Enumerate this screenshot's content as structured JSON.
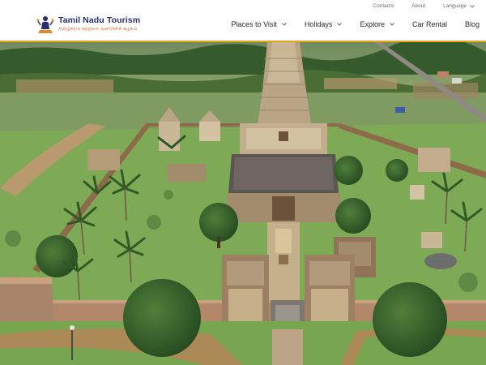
{
  "site": {
    "name": "Tamil Nadu Tourism",
    "tagline": "தமிழ்நாடு சுற்றுலா வளர்ச்சிக் கழகம்"
  },
  "utility_nav": {
    "contacts": "Contacts",
    "about": "About",
    "language": "Language"
  },
  "main_nav": [
    {
      "label": "Places to Visit",
      "has_dropdown": true
    },
    {
      "label": "Holidays",
      "has_dropdown": true
    },
    {
      "label": "Explore",
      "has_dropdown": true
    },
    {
      "label": "Car Rental",
      "has_dropdown": false
    },
    {
      "label": "Blog",
      "has_dropdown": false
    }
  ],
  "colors": {
    "accent": "#e6a623",
    "brand_navy": "#2c2c6e",
    "nav_text": "#2a2a32"
  },
  "icons": {
    "logo": "temple-figure-logo",
    "dropdown": "chevron-down-icon"
  }
}
